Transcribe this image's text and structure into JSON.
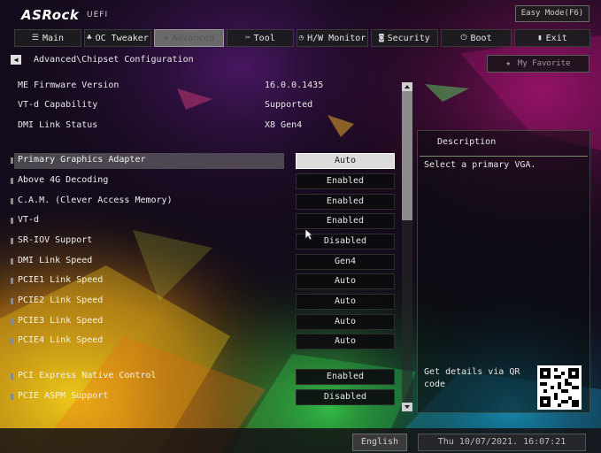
{
  "header": {
    "brand": "ASRock",
    "brand_suffix": "UEFI",
    "easy_mode_label": "Easy Mode(F6)"
  },
  "tabs": [
    {
      "label": "Main",
      "icon": "menu-icon",
      "active": false
    },
    {
      "label": "OC Tweaker",
      "icon": "rocket-icon",
      "active": false
    },
    {
      "label": "Advanced",
      "icon": "star-icon",
      "active": true
    },
    {
      "label": "Tool",
      "icon": "tools-icon",
      "active": false
    },
    {
      "label": "H/W Monitor",
      "icon": "monitor-icon",
      "active": false
    },
    {
      "label": "Security",
      "icon": "shield-icon",
      "active": false
    },
    {
      "label": "Boot",
      "icon": "power-icon",
      "active": false
    },
    {
      "label": "Exit",
      "icon": "exit-icon",
      "active": false
    }
  ],
  "breadcrumb": "Advanced\\Chipset Configuration",
  "favorite_label": "My Favorite",
  "info": [
    {
      "label": "ME Firmware Version",
      "value": "16.0.0.1435"
    },
    {
      "label": "VT-d Capability",
      "value": "Supported"
    },
    {
      "label": "DMI Link Status",
      "value": "X8  Gen4"
    }
  ],
  "settings": [
    {
      "label": "Primary Graphics Adapter",
      "value": "Auto",
      "selected": true
    },
    {
      "label": "Above 4G Decoding",
      "value": "Enabled"
    },
    {
      "label": "C.A.M. (Clever Access Memory)",
      "value": "Enabled"
    },
    {
      "label": "VT-d",
      "value": "Enabled"
    },
    {
      "label": "SR-IOV Support",
      "value": "Disabled"
    },
    {
      "label": "DMI Link Speed",
      "value": "Gen4"
    },
    {
      "label": "PCIE1 Link Speed",
      "value": "Auto"
    },
    {
      "label": "PCIE2 Link Speed",
      "value": "Auto"
    },
    {
      "label": "PCIE3 Link Speed",
      "value": "Auto"
    },
    {
      "label": "PCIE4 Link Speed",
      "value": "Auto"
    },
    {
      "label": "PCI Express Native Control",
      "value": "Enabled"
    },
    {
      "label": "PCIE ASPM Support",
      "value": "Disabled"
    }
  ],
  "description": {
    "title": "Description",
    "text": "Select a primary VGA.",
    "qr_text": "Get details via QR code"
  },
  "footer": {
    "language": "English",
    "datetime": "Thu 10/07/2021. 16:07:21"
  }
}
